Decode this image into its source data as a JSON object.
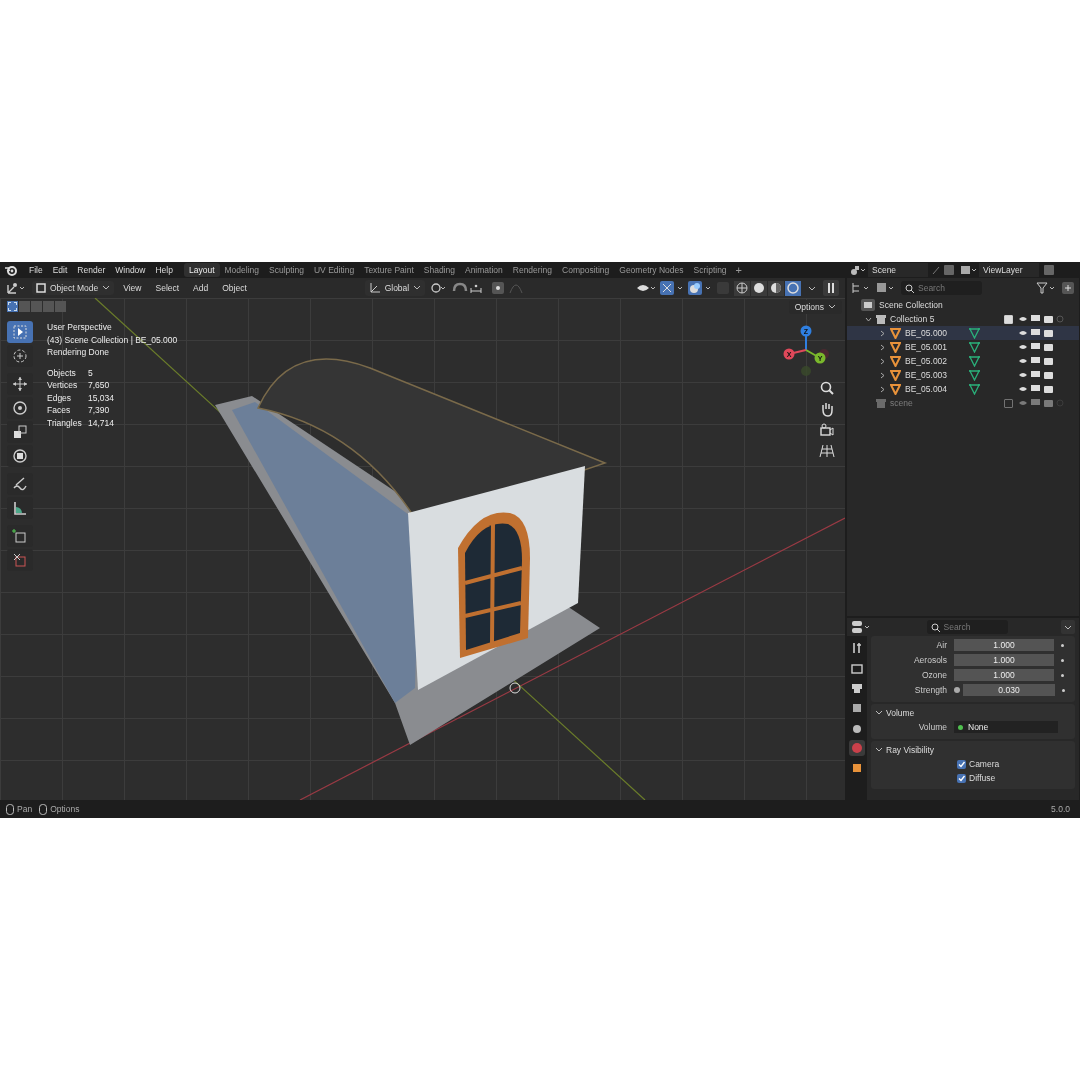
{
  "menu": [
    "File",
    "Edit",
    "Render",
    "Window",
    "Help"
  ],
  "workspaces": [
    {
      "label": "Layout",
      "selected": true
    },
    {
      "label": "Modeling",
      "selected": false
    },
    {
      "label": "Sculpting",
      "selected": false
    },
    {
      "label": "UV Editing",
      "selected": false
    },
    {
      "label": "Texture Paint",
      "selected": false
    },
    {
      "label": "Shading",
      "selected": false
    },
    {
      "label": "Animation",
      "selected": false
    },
    {
      "label": "Rendering",
      "selected": false
    },
    {
      "label": "Compositing",
      "selected": false
    },
    {
      "label": "Geometry Nodes",
      "selected": false
    },
    {
      "label": "Scripting",
      "selected": false
    }
  ],
  "add_workspace": "+",
  "scene": {
    "name": "Scene",
    "view_layer": "ViewLayer"
  },
  "viewport_header": {
    "mode": "Object Mode",
    "menus": [
      "View",
      "Select",
      "Add",
      "Object"
    ],
    "orientation": "Global",
    "options": "Options",
    "shading_modes": [
      {
        "kind": "wireframe",
        "selected": false
      },
      {
        "kind": "solid",
        "selected": false
      },
      {
        "kind": "material",
        "selected": false
      },
      {
        "kind": "rendered",
        "selected": true
      }
    ]
  },
  "select_modes": [
    {
      "selected": true
    },
    {
      "selected": false
    },
    {
      "selected": false
    },
    {
      "selected": false
    },
    {
      "selected": false
    }
  ],
  "overlay": {
    "lines": [
      "User Perspective",
      "(43) Scene Collection | BE_05.000",
      "Rendering Done"
    ],
    "stats": [
      {
        "label": "Objects",
        "value": "5"
      },
      {
        "label": "Vertices",
        "value": "7,650"
      },
      {
        "label": "Edges",
        "value": "15,034"
      },
      {
        "label": "Faces",
        "value": "7,390"
      },
      {
        "label": "Triangles",
        "value": "14,714"
      }
    ]
  },
  "tools": [
    {
      "kind": "select",
      "selected": true
    },
    {
      "kind": "cursor",
      "selected": false
    },
    {
      "kind": "move",
      "selected": false
    },
    {
      "kind": "rotate",
      "selected": false
    },
    {
      "kind": "scale",
      "selected": false
    },
    {
      "kind": "transform",
      "selected": false
    },
    {
      "kind": "annotate",
      "selected": false
    },
    {
      "kind": "measure",
      "selected": false
    },
    {
      "kind": "add-cube",
      "selected": false
    },
    {
      "kind": "cut",
      "selected": false
    }
  ],
  "gizmo": {
    "axes": [
      {
        "label": "Z",
        "color": "#2f7fe0"
      },
      {
        "label": "X",
        "color": "#e0485a"
      },
      {
        "label": "Y",
        "color": "#7ab82c"
      }
    ]
  },
  "outliner": {
    "search": {
      "placeholder": "Search"
    },
    "root": "Scene Collection",
    "collections": [
      {
        "name": "Collection 5",
        "checked": true,
        "disabled": false,
        "expanded": true,
        "children": [
          {
            "name": "BE_05.000",
            "selected": true
          },
          {
            "name": "BE_05.001",
            "selected": false
          },
          {
            "name": "BE_05.002",
            "selected": false
          },
          {
            "name": "BE_05.003",
            "selected": false
          },
          {
            "name": "BE_05.004",
            "selected": false
          }
        ]
      },
      {
        "name": "scene",
        "checked": false,
        "disabled": true
      }
    ]
  },
  "properties": {
    "search": {
      "placeholder": "Search"
    },
    "tabs": [
      {
        "kind": "tool",
        "selected": false
      },
      {
        "kind": "render",
        "selected": false
      },
      {
        "kind": "output",
        "selected": false
      },
      {
        "kind": "view-layer",
        "selected": false
      },
      {
        "kind": "scene",
        "selected": false
      },
      {
        "kind": "world",
        "selected": true
      },
      {
        "kind": "object",
        "selected": false
      }
    ],
    "fields": [
      {
        "kind": "value",
        "label": "Air",
        "value": "1.000"
      },
      {
        "kind": "value",
        "label": "Aerosols",
        "value": "1.000"
      },
      {
        "kind": "value",
        "label": "Ozone",
        "value": "1.000"
      },
      {
        "kind": "socket",
        "label": "Strength",
        "value": "0.030"
      }
    ],
    "panels": [
      {
        "title": "Volume",
        "expanded": true,
        "fields": [
          {
            "kind": "link",
            "label": "Volume",
            "value": "None"
          }
        ]
      },
      {
        "title": "Ray Visibility",
        "expanded": true,
        "checkboxes": [
          {
            "label": "Camera",
            "checked": true
          },
          {
            "label": "Diffuse",
            "checked": true
          }
        ]
      }
    ]
  },
  "status_bar": {
    "items": [
      "Pan",
      "Options"
    ],
    "version": "5.0.0"
  }
}
